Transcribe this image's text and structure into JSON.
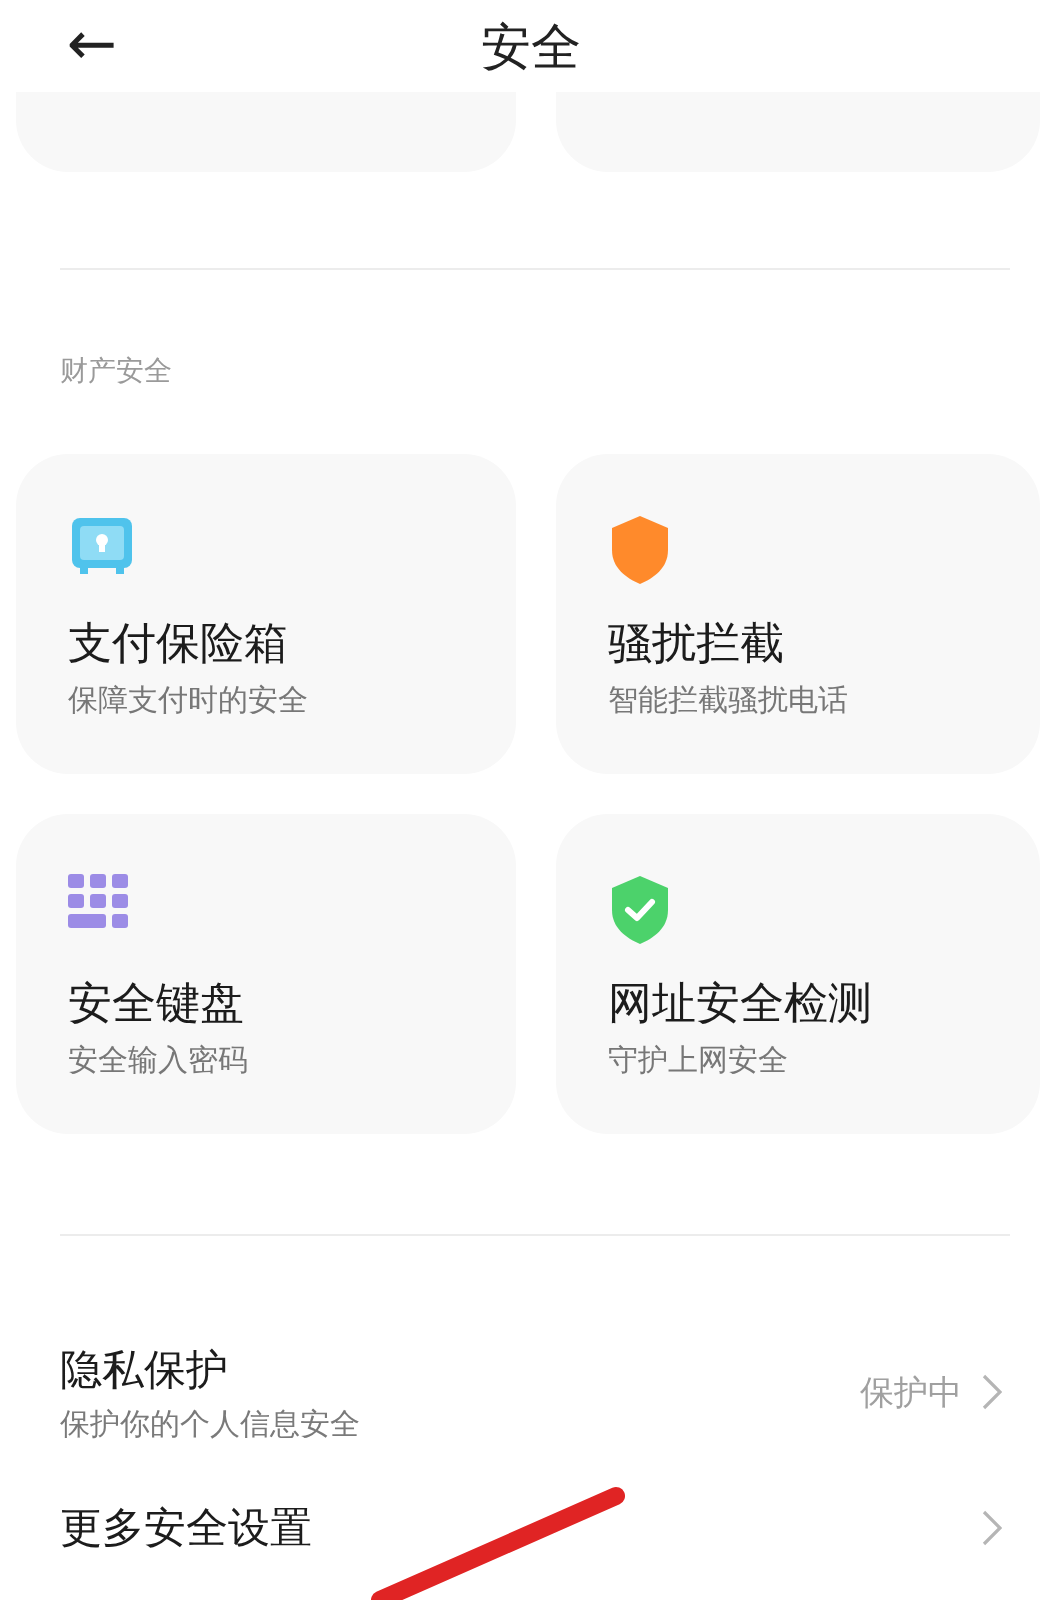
{
  "header": {
    "back": "←",
    "title": "安全"
  },
  "section": {
    "label": "财产安全"
  },
  "cards": [
    {
      "title": "支付保险箱",
      "subtitle": "保障支付时的安全"
    },
    {
      "title": "骚扰拦截",
      "subtitle": "智能拦截骚扰电话"
    },
    {
      "title": "安全键盘",
      "subtitle": "安全输入密码"
    },
    {
      "title": "网址安全检测",
      "subtitle": "守护上网安全"
    }
  ],
  "rows": [
    {
      "title": "隐私保护",
      "subtitle": "保护你的个人信息安全",
      "value": "保护中"
    },
    {
      "title": "更多安全设置"
    }
  ]
}
